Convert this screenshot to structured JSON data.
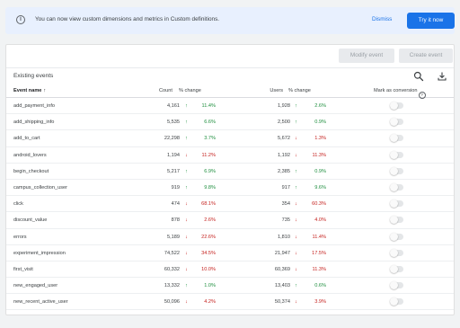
{
  "banner": {
    "message": "You can now view custom dimensions and metrics in Custom definitions.",
    "dismiss_label": "Dismiss",
    "try_label": "Try it now"
  },
  "toolbar": {
    "modify_label": "Modify event",
    "create_label": "Create event"
  },
  "table": {
    "title": "Existing events",
    "headers": {
      "name": "Event name",
      "count": "Count",
      "count_change": "% change",
      "users": "Users",
      "users_change": "% change",
      "mark": "Mark as conversion"
    },
    "rows": [
      {
        "name": "add_payment_info",
        "count": "4,161",
        "count_dir": "up",
        "count_pct": "11.4%",
        "users": "1,928",
        "users_dir": "up",
        "users_pct": "2.6%"
      },
      {
        "name": "add_shipping_info",
        "count": "5,535",
        "count_dir": "up",
        "count_pct": "6.6%",
        "users": "2,500",
        "users_dir": "up",
        "users_pct": "0.9%"
      },
      {
        "name": "add_to_cart",
        "count": "22,298",
        "count_dir": "up",
        "count_pct": "3.7%",
        "users": "5,672",
        "users_dir": "down",
        "users_pct": "1.3%"
      },
      {
        "name": "android_lovers",
        "count": "1,194",
        "count_dir": "down",
        "count_pct": "11.2%",
        "users": "1,192",
        "users_dir": "down",
        "users_pct": "11.3%"
      },
      {
        "name": "begin_checkout",
        "count": "5,217",
        "count_dir": "up",
        "count_pct": "6.9%",
        "users": "2,385",
        "users_dir": "up",
        "users_pct": "0.9%"
      },
      {
        "name": "campus_collection_user",
        "count": "919",
        "count_dir": "up",
        "count_pct": "9.8%",
        "users": "917",
        "users_dir": "up",
        "users_pct": "9.6%"
      },
      {
        "name": "click",
        "count": "474",
        "count_dir": "down",
        "count_pct": "68.1%",
        "users": "354",
        "users_dir": "down",
        "users_pct": "60.3%"
      },
      {
        "name": "discount_value",
        "count": "878",
        "count_dir": "down",
        "count_pct": "2.6%",
        "users": "735",
        "users_dir": "down",
        "users_pct": "4.0%"
      },
      {
        "name": "errors",
        "count": "5,189",
        "count_dir": "down",
        "count_pct": "22.6%",
        "users": "1,810",
        "users_dir": "down",
        "users_pct": "11.4%"
      },
      {
        "name": "experiment_impression",
        "count": "74,522",
        "count_dir": "down",
        "count_pct": "34.5%",
        "users": "21,947",
        "users_dir": "down",
        "users_pct": "17.5%"
      },
      {
        "name": "first_visit",
        "count": "60,332",
        "count_dir": "down",
        "count_pct": "10.0%",
        "users": "60,369",
        "users_dir": "down",
        "users_pct": "11.3%"
      },
      {
        "name": "new_engaged_user",
        "count": "13,332",
        "count_dir": "up",
        "count_pct": "1.0%",
        "users": "13,403",
        "users_dir": "up",
        "users_pct": "0.6%"
      },
      {
        "name": "new_recent_active_user",
        "count": "50,096",
        "count_dir": "down",
        "count_pct": "4.2%",
        "users": "50,374",
        "users_dir": "down",
        "users_pct": "3.9%"
      }
    ]
  },
  "icons": {
    "info": "info-icon",
    "search": "search-icon",
    "download": "download-icon",
    "sort": "arrow-up-icon",
    "help": "help-icon"
  },
  "colors": {
    "accent": "#1a73e8",
    "up": "#1e8e3e",
    "down": "#c5221f",
    "banner_bg": "#e8f0fe"
  }
}
